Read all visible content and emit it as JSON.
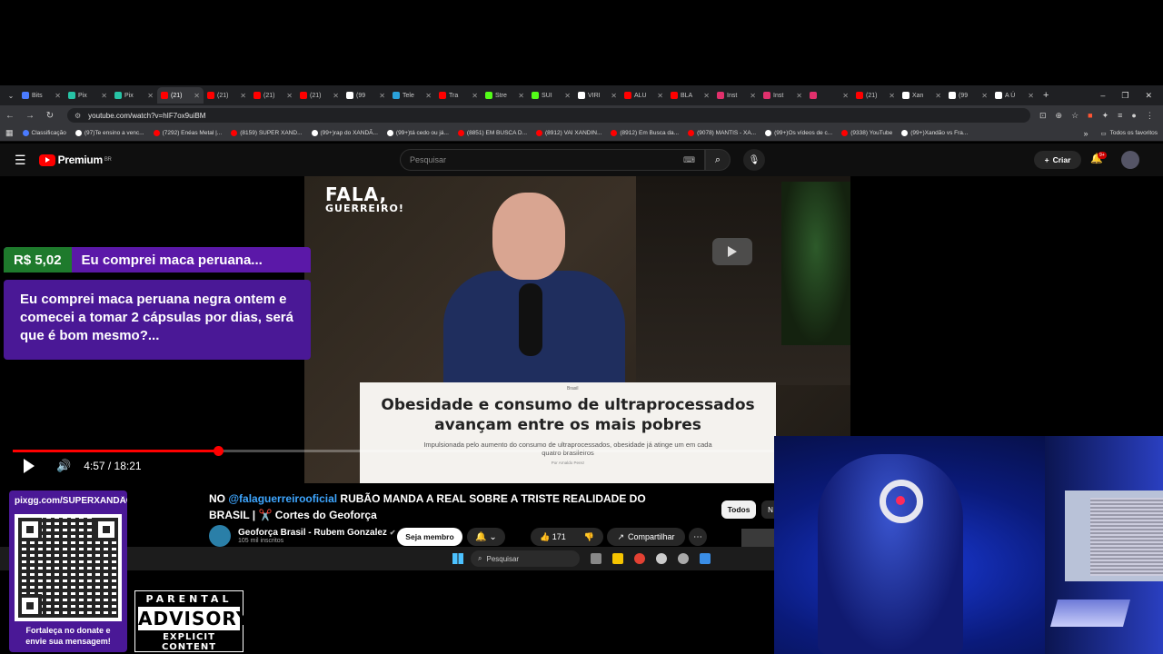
{
  "browser": {
    "tabs": [
      {
        "label": "Bits",
        "color": "#4a7bff"
      },
      {
        "label": "Pix",
        "color": "#27c4a6"
      },
      {
        "label": "Pix",
        "color": "#27c4a6"
      },
      {
        "label": "(21)",
        "color": "#ff0000",
        "active": true
      },
      {
        "label": "(21)",
        "color": "#ff0000"
      },
      {
        "label": "(21)",
        "color": "#ff0000"
      },
      {
        "label": "(21)",
        "color": "#ff0000"
      },
      {
        "label": "(99",
        "color": "#ffffff"
      },
      {
        "label": "Tele",
        "color": "#2aa1da"
      },
      {
        "label": "Tra",
        "color": "#ff0000"
      },
      {
        "label": "Stre",
        "color": "#53fc18"
      },
      {
        "label": "SUI",
        "color": "#53fc18"
      },
      {
        "label": "VIRI",
        "color": "#ffffff"
      },
      {
        "label": "ALU",
        "color": "#ff0000"
      },
      {
        "label": "BLA",
        "color": "#ff0000"
      },
      {
        "label": "Inst",
        "color": "#e1306c"
      },
      {
        "label": "Inst",
        "color": "#e1306c"
      },
      {
        "label": "",
        "color": "#e1306c"
      },
      {
        "label": "(21)",
        "color": "#ff0000"
      },
      {
        "label": "Xan",
        "color": "#ffffff"
      },
      {
        "label": "(99",
        "color": "#ffffff"
      },
      {
        "label": "A Ú",
        "color": "#ffffff"
      }
    ],
    "new_tab": "+",
    "window_controls": {
      "minimize": "–",
      "maximize": "❐",
      "close": "✕"
    },
    "url": "youtube.com/watch?v=hIF7ox9uiBM",
    "bookmarks": [
      {
        "label": "Classificação",
        "color": "#4a7bff"
      },
      {
        "label": "(97)Te ensino a venc...",
        "color": "#ffffff"
      },
      {
        "label": "(7292) Enéas Metal |...",
        "color": "#ff0000"
      },
      {
        "label": "(8159) SUPER XAND...",
        "color": "#ff0000"
      },
      {
        "label": "(99+)rap do XANDÃ...",
        "color": "#ffffff"
      },
      {
        "label": "(99+)tá cedo ou já...",
        "color": "#ffffff"
      },
      {
        "label": "(8851) EM BUSCA D...",
        "color": "#ff0000"
      },
      {
        "label": "(8912) VAI XANDIN...",
        "color": "#ff0000"
      },
      {
        "label": "(8912) Em Busca da...",
        "color": "#ff0000"
      },
      {
        "label": "(9078) MANTIS - XA...",
        "color": "#ff0000"
      },
      {
        "label": "(99+)Os vídeos de c...",
        "color": "#ffffff"
      },
      {
        "label": "(9338) YouTube",
        "color": "#ff0000"
      },
      {
        "label": "(99+)Xandão vs Fra...",
        "color": "#ffffff"
      }
    ],
    "bookmarks_more": "»",
    "all_favorites": "Todos os favoritos"
  },
  "youtube": {
    "logo_text": "Premium",
    "logo_region": "BR",
    "search_placeholder": "Pesquisar",
    "create_label": "Criar",
    "notif_badge": "9+"
  },
  "video": {
    "overlay_logo_line1": "FALA,",
    "overlay_logo_line2": "GUERREIRO!",
    "news_tag": "Brasil",
    "news_headline": "Obesidade e consumo de ultraprocessados avançam entre os mais pobres",
    "news_sub": "Impulsionada pelo aumento do consumo de ultraprocessados, obesidade já atinge um em cada quatro brasileiros",
    "news_byline": "Por Arnaldo Perez",
    "time": "4:57 / 18:21",
    "progress": 0.27,
    "title_prefix": "NO ",
    "title_mention": "@falaguerreirooficial",
    "title_rest": " RUBÃO MANDA A REAL SOBRE A TRISTE REALIDADE DO BRASIL | ✂️ Cortes do Geoforça",
    "channel_name": "Geoforça Brasil - Rubem Gonzalez",
    "channel_subs": "105 mil inscritos",
    "member_label": "Seja membro",
    "likes": "171",
    "share_label": "Compartilhar",
    "chip_all": "Todos",
    "chip_next": "N"
  },
  "superchat": {
    "amount": "R$ 5,02",
    "title": "Eu comprei maca peruana...",
    "message": "Eu comprei maca peruana negra ontem e comecei a tomar 2 cápsulas por dias, será que é bom mesmo?..."
  },
  "taskbar": {
    "search": "Pesquisar"
  },
  "pix": {
    "title": "pixgg.com/SUPERXANDÃO",
    "footer": "Fortaleça no donate e envie sua mensagem!"
  },
  "parental": {
    "line1": "PARENTAL",
    "line2": "ADVISORY",
    "line3": "EXPLICIT CONTENT"
  }
}
